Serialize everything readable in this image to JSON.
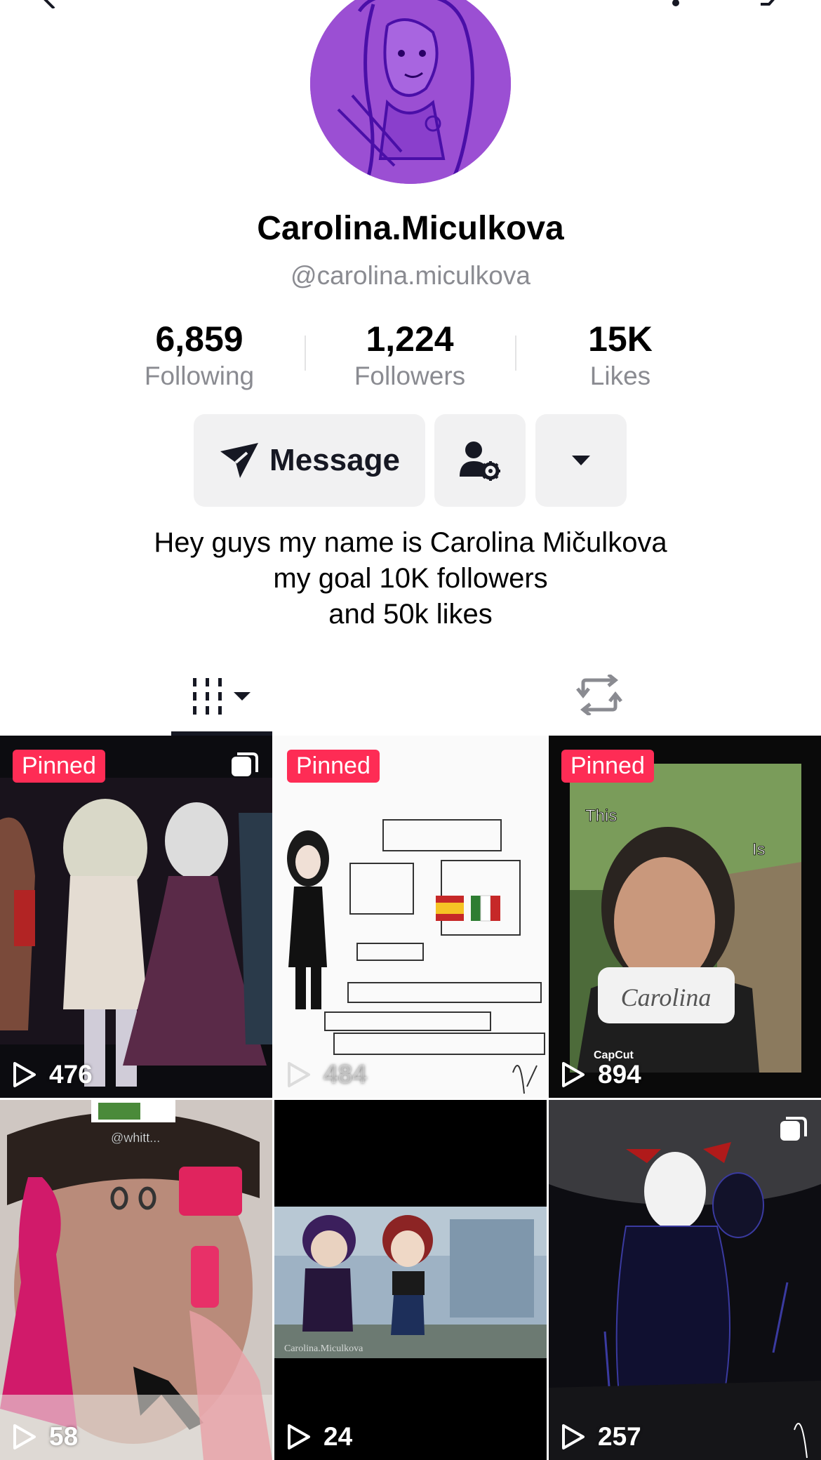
{
  "profile": {
    "display_name": "Carolina.Miculkova",
    "username": "@carolina.miculkova",
    "bio_lines": [
      "Hey guys my name is Carolina Mičulkova",
      "my goal 10K followers",
      "and 50k likes"
    ]
  },
  "stats": [
    {
      "value": "6,859",
      "label": "Following"
    },
    {
      "value": "1,224",
      "label": "Followers"
    },
    {
      "value": "15K",
      "label": "Likes"
    }
  ],
  "actions": {
    "message_label": "Message",
    "friend_icon": "person-gear-icon",
    "more_icon": "caret-down-icon"
  },
  "tabs": {
    "videos_icon": "grid-bars-icon",
    "repost_icon": "repost-icon"
  },
  "videos": [
    {
      "pinned_label": "Pinned",
      "views": "476"
    },
    {
      "pinned_label": "Pinned",
      "views": "484"
    },
    {
      "pinned_label": "Pinned",
      "views": "894",
      "overlay_texts": [
        "This",
        "Is",
        "Carolina",
        "CapCut"
      ]
    },
    {
      "views": "58",
      "overlay_texts": [
        "@whitt..."
      ]
    },
    {
      "views": "24",
      "overlay_texts": [
        "Carolina.Miculkova"
      ]
    },
    {
      "views": "257"
    }
  ],
  "colors": {
    "pinned_bg": "#fe2c55",
    "button_bg": "#f1f1f2",
    "secondary_text": "#8a8b91",
    "avatar_bg": "#9b4fd3"
  }
}
